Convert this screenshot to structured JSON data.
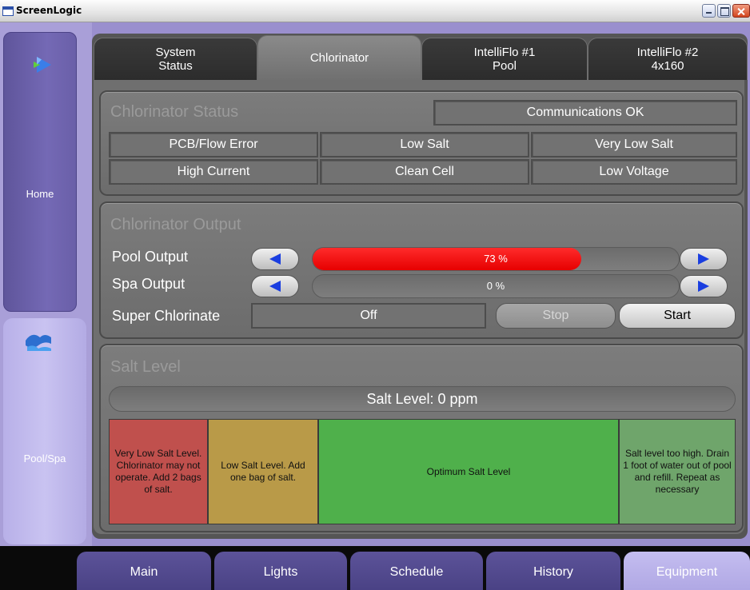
{
  "window": {
    "title": "ScreenLogic"
  },
  "nav": {
    "home_label": "Home",
    "pool_spa_label": "Pool/Spa"
  },
  "tabs": [
    {
      "line1": "System",
      "line2": "Status",
      "active": false
    },
    {
      "line1": "Chlorinator",
      "line2": "",
      "active": true
    },
    {
      "line1": "IntelliFlo #1",
      "line2": "Pool",
      "active": false
    },
    {
      "line1": "IntelliFlo #2",
      "line2": "4x160",
      "active": false
    }
  ],
  "status": {
    "title": "Chlorinator Status",
    "comm": "Communications OK",
    "flags": [
      "PCB/Flow Error",
      "Low Salt",
      "Very Low Salt",
      "High Current",
      "Clean Cell",
      "Low Voltage"
    ]
  },
  "output": {
    "title": "Chlorinator Output",
    "pool_label": "Pool Output",
    "pool_value_text": "73 %",
    "pool_percent": 73,
    "spa_label": "Spa Output",
    "spa_value_text": "0 %",
    "spa_percent": 0,
    "super_label": "Super Chlorinate",
    "super_value": "Off",
    "stop_label": "Stop",
    "start_label": "Start"
  },
  "salt": {
    "title": "Salt Level",
    "readout": "Salt Level: 0 ppm",
    "zones": [
      {
        "text": "Very Low Salt Level. Chlorinator may not operate. Add 2 bags of salt.",
        "color": "#c0504d"
      },
      {
        "text": "Low Salt Level. Add one bag of salt.",
        "color": "#b99a48"
      },
      {
        "text": "Optimum Salt Level",
        "color": "#4fb04b"
      },
      {
        "text": "Salt level too high. Drain 1 foot of water out of pool and refill. Repeat as necessary",
        "color": "#6fa56b"
      }
    ]
  },
  "bottom_tabs": [
    {
      "label": "Main",
      "active": false
    },
    {
      "label": "Lights",
      "active": false
    },
    {
      "label": "Schedule",
      "active": false
    },
    {
      "label": "History",
      "active": false
    },
    {
      "label": "Equipment",
      "active": true
    }
  ],
  "colors": {
    "frame": "#9a8fce",
    "panel": "#6f6f6f",
    "bar_fill": "#ff0000",
    "nav_dark": "#6a5fa8"
  }
}
